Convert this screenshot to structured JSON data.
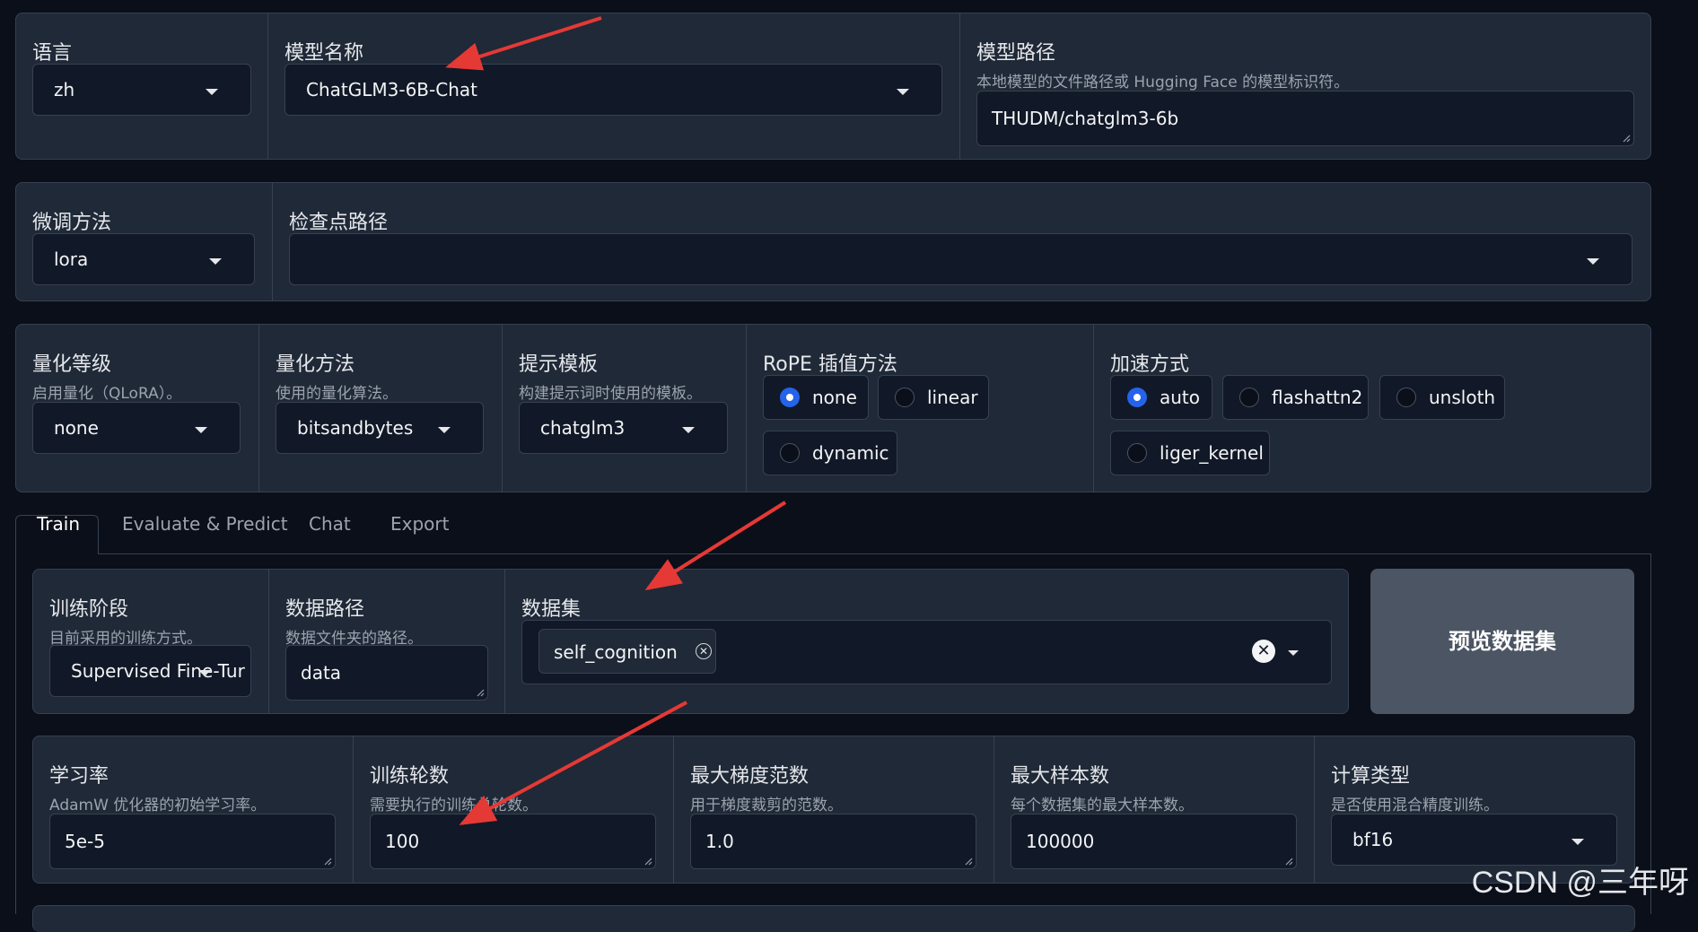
{
  "top": {
    "lang": {
      "label": "语言",
      "value": "zh"
    },
    "model_name": {
      "label": "模型名称",
      "value": "ChatGLM3-6B-Chat"
    },
    "model_path": {
      "label": "模型路径",
      "info": "本地模型的文件路径或 Hugging Face 的模型标识符。",
      "value": "THUDM/chatglm3-6b"
    }
  },
  "finetune": {
    "method": {
      "label": "微调方法",
      "value": "lora"
    },
    "checkpoint": {
      "label": "检查点路径",
      "value": ""
    }
  },
  "advanced": {
    "quant_bit": {
      "label": "量化等级",
      "info": "启用量化（QLoRA）。",
      "value": "none"
    },
    "quant_method": {
      "label": "量化方法",
      "info": "使用的量化算法。",
      "value": "bitsandbytes"
    },
    "template": {
      "label": "提示模板",
      "info": "构建提示词时使用的模板。",
      "value": "chatglm3"
    },
    "rope": {
      "label": "RoPE 插值方法",
      "options": [
        "none",
        "linear",
        "dynamic"
      ],
      "selected": "none"
    },
    "booster": {
      "label": "加速方式",
      "options": [
        "auto",
        "flashattn2",
        "unsloth",
        "liger_kernel"
      ],
      "selected": "auto"
    }
  },
  "tabs": [
    {
      "label": "Train",
      "active": true
    },
    {
      "label": "Evaluate & Predict",
      "active": false
    },
    {
      "label": "Chat",
      "active": false
    },
    {
      "label": "Export",
      "active": false
    }
  ],
  "train": {
    "stage": {
      "label": "训练阶段",
      "info": "目前采用的训练方式。",
      "value": "Supervised Fine-Tur"
    },
    "dataset_dir": {
      "label": "数据路径",
      "info": "数据文件夹的路径。",
      "value": "data"
    },
    "dataset": {
      "label": "数据集",
      "chips": [
        "self_cognition"
      ]
    },
    "preview_button": "预览数据集",
    "learning_rate": {
      "label": "学习率",
      "info": "AdamW 优化器的初始学习率。",
      "value": "5e-5"
    },
    "num_epochs": {
      "label": "训练轮数",
      "info": "需要执行的训练总轮数。",
      "value": "100"
    },
    "max_grad_norm": {
      "label": "最大梯度范数",
      "info": "用于梯度裁剪的范数。",
      "value": "1.0"
    },
    "max_samples": {
      "label": "最大样本数",
      "info": "每个数据集的最大样本数。",
      "value": "100000"
    },
    "compute_type": {
      "label": "计算类型",
      "info": "是否使用混合精度训练。",
      "value": "bf16"
    }
  },
  "watermark": "CSDN @三年呀",
  "colors": {
    "accent": "#2563eb",
    "annotation_arrow": "#e53935"
  }
}
